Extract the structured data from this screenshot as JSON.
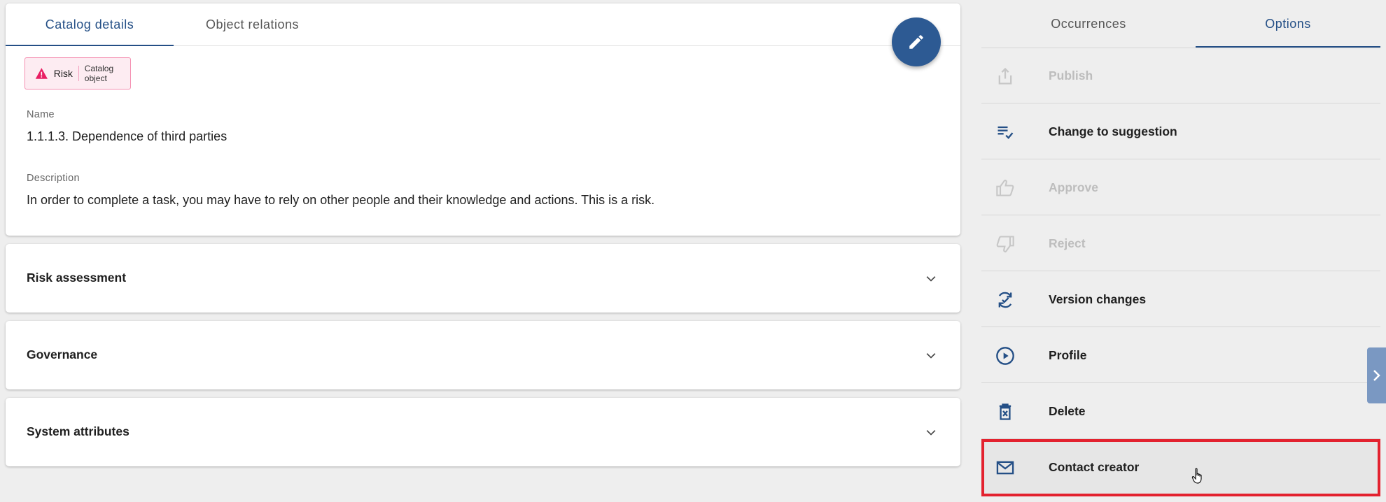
{
  "tabs_left": [
    "Catalog details",
    "Object relations"
  ],
  "chip": {
    "label": "Risk",
    "type": "Catalog object",
    "color": "#e91e63"
  },
  "fields": {
    "name_label": "Name",
    "name_value": "1.1.1.3. Dependence of third parties",
    "description_label": "Description",
    "description_value": "In order to complete a task, you may have to rely on other people and their knowledge and actions. This is a risk."
  },
  "accordions": [
    "Risk assessment",
    "Governance",
    "System attributes"
  ],
  "tabs_right": [
    "Occurrences",
    "Options"
  ],
  "options": [
    {
      "label": "Publish",
      "icon": "share-icon",
      "disabled": true
    },
    {
      "label": "Change to suggestion",
      "icon": "playlist-check-icon",
      "disabled": false
    },
    {
      "label": "Approve",
      "icon": "thumb-up-icon",
      "disabled": true
    },
    {
      "label": "Reject",
      "icon": "thumb-down-icon",
      "disabled": true
    },
    {
      "label": "Version changes",
      "icon": "sync-check-icon",
      "disabled": false
    },
    {
      "label": "Profile",
      "icon": "play-circle-icon",
      "disabled": false
    },
    {
      "label": "Delete",
      "icon": "trash-icon",
      "disabled": false
    },
    {
      "label": "Contact creator",
      "icon": "mail-icon",
      "disabled": false
    }
  ],
  "colors": {
    "primary": "#244f86",
    "fab": "#2d5a93",
    "highlight": "#e3222f",
    "disabled": "#bdbdbd"
  }
}
